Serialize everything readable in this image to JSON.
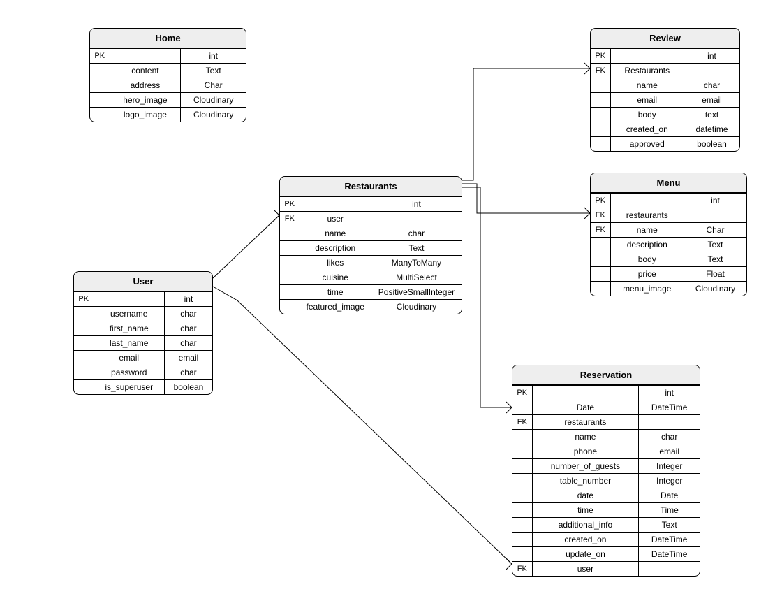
{
  "entities": {
    "home": {
      "title": "Home",
      "rows": [
        {
          "key": "PK",
          "name": "",
          "type": "int"
        },
        {
          "key": "",
          "name": "content",
          "type": "Text"
        },
        {
          "key": "",
          "name": "address",
          "type": "Char"
        },
        {
          "key": "",
          "name": "hero_image",
          "type": "Cloudinary"
        },
        {
          "key": "",
          "name": "logo_image",
          "type": "Cloudinary"
        }
      ]
    },
    "user": {
      "title": "User",
      "rows": [
        {
          "key": "PK",
          "name": "",
          "type": "int"
        },
        {
          "key": "",
          "name": "username",
          "type": "char"
        },
        {
          "key": "",
          "name": "first_name",
          "type": "char"
        },
        {
          "key": "",
          "name": "last_name",
          "type": "char"
        },
        {
          "key": "",
          "name": "email",
          "type": "email"
        },
        {
          "key": "",
          "name": "password",
          "type": "char"
        },
        {
          "key": "",
          "name": "is_superuser",
          "type": "boolean"
        }
      ]
    },
    "restaurants": {
      "title": "Restaurants",
      "rows": [
        {
          "key": "PK",
          "name": "",
          "type": "int"
        },
        {
          "key": "FK",
          "name": "user",
          "type": ""
        },
        {
          "key": "",
          "name": "name",
          "type": "char"
        },
        {
          "key": "",
          "name": "description",
          "type": "Text"
        },
        {
          "key": "",
          "name": "likes",
          "type": "ManyToMany"
        },
        {
          "key": "",
          "name": "cuisine",
          "type": "MultiSelect"
        },
        {
          "key": "",
          "name": "time",
          "type": "PositiveSmallInteger"
        },
        {
          "key": "",
          "name": "featured_image",
          "type": "Cloudinary"
        }
      ]
    },
    "review": {
      "title": "Review",
      "rows": [
        {
          "key": "PK",
          "name": "",
          "type": "int"
        },
        {
          "key": "FK",
          "name": "Restaurants",
          "type": ""
        },
        {
          "key": "",
          "name": "name",
          "type": "char"
        },
        {
          "key": "",
          "name": "email",
          "type": "email"
        },
        {
          "key": "",
          "name": "body",
          "type": "text"
        },
        {
          "key": "",
          "name": "created_on",
          "type": "datetime"
        },
        {
          "key": "",
          "name": "approved",
          "type": "boolean"
        }
      ]
    },
    "menu": {
      "title": "Menu",
      "rows": [
        {
          "key": "PK",
          "name": "",
          "type": "int"
        },
        {
          "key": "FK",
          "name": "restaurants",
          "type": ""
        },
        {
          "key": "FK",
          "name": "name",
          "type": "Char"
        },
        {
          "key": "",
          "name": "description",
          "type": "Text"
        },
        {
          "key": "",
          "name": "body",
          "type": "Text"
        },
        {
          "key": "",
          "name": "price",
          "type": "Float"
        },
        {
          "key": "",
          "name": "menu_image",
          "type": "Cloudinary"
        }
      ]
    },
    "reservation": {
      "title": "Reservation",
      "rows": [
        {
          "key": "PK",
          "name": "",
          "type": "int"
        },
        {
          "key": "",
          "name": "Date",
          "type": "DateTime"
        },
        {
          "key": "FK",
          "name": "restaurants",
          "type": ""
        },
        {
          "key": "",
          "name": "name",
          "type": "char"
        },
        {
          "key": "",
          "name": "phone",
          "type": "email"
        },
        {
          "key": "",
          "name": "number_of_guests",
          "type": "Integer"
        },
        {
          "key": "",
          "name": "table_number",
          "type": "Integer"
        },
        {
          "key": "",
          "name": "date",
          "type": "Date"
        },
        {
          "key": "",
          "name": "time",
          "type": "Time"
        },
        {
          "key": "",
          "name": "additional_info",
          "type": "Text"
        },
        {
          "key": "",
          "name": "created_on",
          "type": "DateTime"
        },
        {
          "key": "",
          "name": "update_on",
          "type": "DateTime"
        },
        {
          "key": "FK",
          "name": "user",
          "type": ""
        }
      ]
    }
  },
  "relations": [
    {
      "from": "user",
      "to": "restaurants"
    },
    {
      "from": "restaurants",
      "to": "review"
    },
    {
      "from": "restaurants",
      "to": "menu"
    },
    {
      "from": "restaurants",
      "to": "reservation"
    },
    {
      "from": "user",
      "to": "reservation"
    }
  ]
}
